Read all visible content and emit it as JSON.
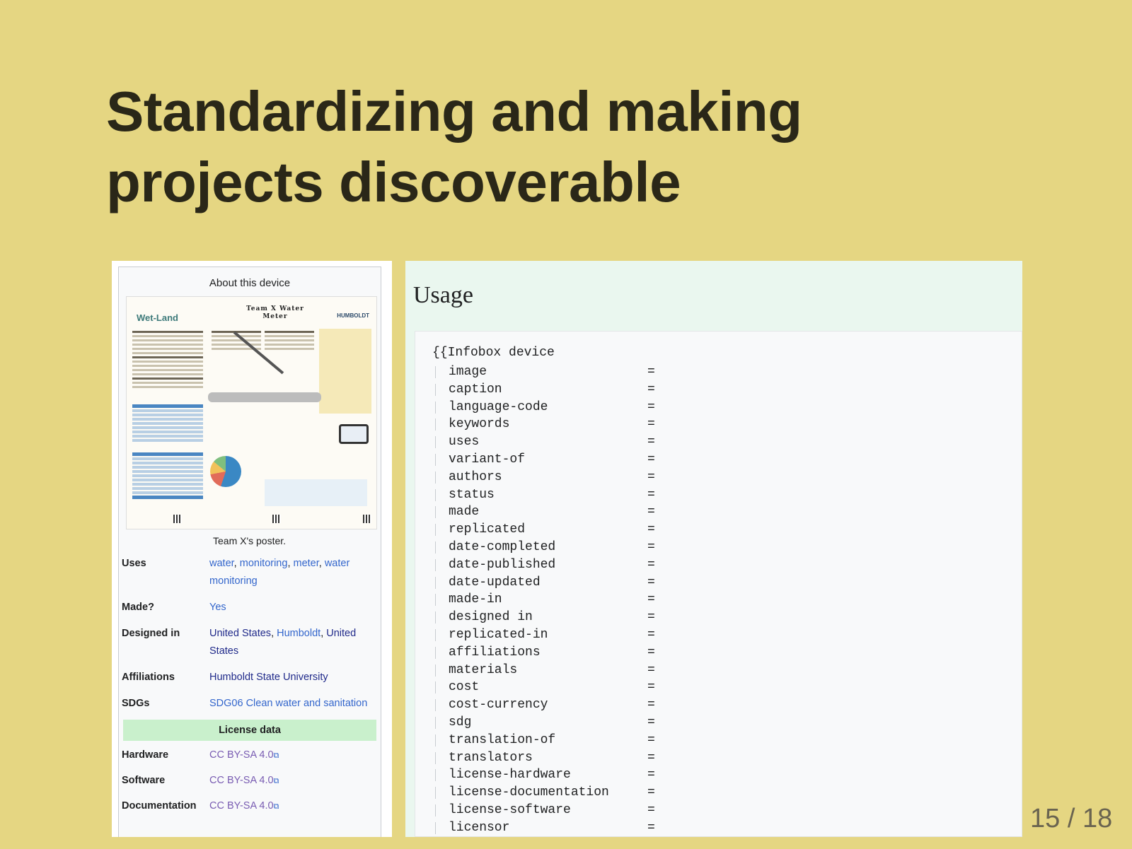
{
  "slide": {
    "title_line1": "Standardizing and making",
    "title_line2": "projects discoverable",
    "page_number": "15 / 18"
  },
  "infobox": {
    "header": "About this device",
    "poster": {
      "brand": "Wet-Land",
      "title": "Team X Water Meter",
      "org": "HUMBOLDT"
    },
    "caption": "Team X's poster.",
    "rows": {
      "uses": {
        "label": "Uses",
        "values": [
          "water",
          "monitoring",
          "meter",
          "water monitoring"
        ]
      },
      "made": {
        "label": "Made?",
        "value": "Yes"
      },
      "designed_in": {
        "label": "Designed in",
        "values": [
          "United States",
          "Humboldt",
          "United States"
        ]
      },
      "affiliations": {
        "label": "Affiliations",
        "value": "Humboldt State University"
      },
      "sdgs": {
        "label": "SDGs",
        "value": "SDG06 Clean water and sanitation"
      }
    },
    "license_header": "License data",
    "licenses": {
      "hardware": {
        "label": "Hardware",
        "value": "CC BY-SA 4.0"
      },
      "software": {
        "label": "Software",
        "value": "CC BY-SA 4.0"
      },
      "documentation": {
        "label": "Documentation",
        "value": "CC BY-SA 4.0"
      }
    }
  },
  "usage": {
    "title": "Usage",
    "template_open": "{{Infobox device",
    "equals_sign": "=",
    "params": [
      "image",
      "caption",
      "language-code",
      "keywords",
      "uses",
      "variant-of",
      "authors",
      "status",
      "made",
      "replicated",
      "date-completed",
      "date-published",
      "date-updated",
      "made-in",
      "designed in",
      "replicated-in",
      "affiliations",
      "materials",
      "cost",
      "cost-currency",
      "sdg",
      "translation-of",
      "translators",
      "license-hardware",
      "license-documentation",
      "license-software",
      "licensor"
    ]
  },
  "colors": {
    "slide_background": "#e5d682",
    "link": "#3366cc",
    "visited_link": "#795cb2",
    "license_header_bg": "#c9f0cc",
    "usage_background": "#eaf7ef"
  },
  "icons": {
    "external_link": "external-link-icon"
  }
}
